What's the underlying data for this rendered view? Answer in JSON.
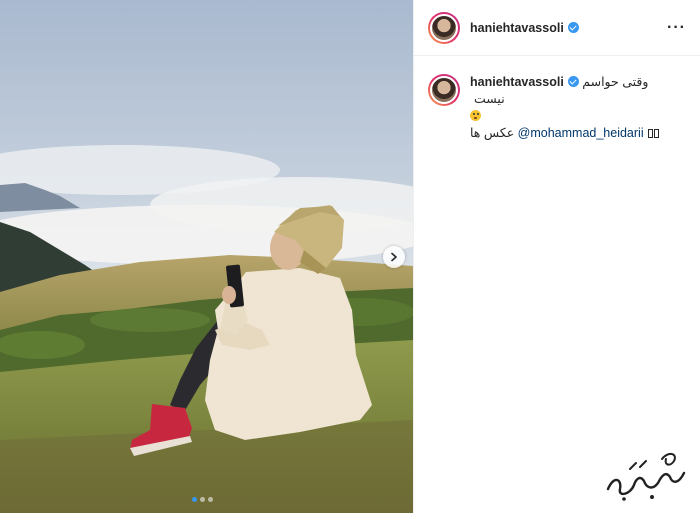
{
  "post": {
    "username": "haniehtavassoli",
    "verified": true,
    "caption_line1": "وقتی حواسم نیست",
    "caption_emoji": "face-with-open-mouth-emoji",
    "caption_mention": "@mohammad_heidarii",
    "caption_suffix": "عکس ها",
    "more_options_icon": "ellipsis-icon"
  },
  "carousel": {
    "next_icon": "chevron-right-icon",
    "slides": 3,
    "active_slide": 1
  },
  "colors": {
    "verified_blue": "#3897f0",
    "mention_blue": "#00376b",
    "text": "#262626"
  }
}
